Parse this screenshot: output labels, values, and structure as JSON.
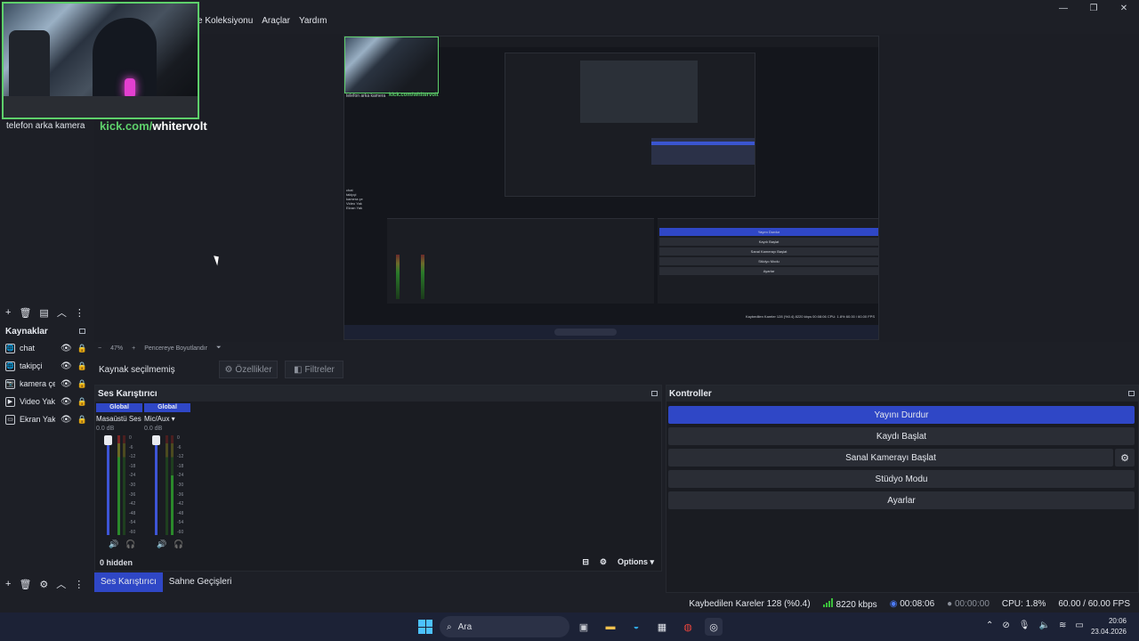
{
  "menu": {
    "items": [
      "e Koleksiyonu",
      "Araçlar",
      "Yardım"
    ]
  },
  "window_controls": {
    "minimize": "—",
    "maximize": "❐",
    "close": "✕"
  },
  "webcam": {
    "overlay_prefix": "kick.com/",
    "overlay_user": "whitervolt"
  },
  "scenes": {
    "items": [
      "telefon arka kamera"
    ],
    "toolbar": [
      "+",
      "🗑",
      "▤",
      "︿",
      "⋮"
    ]
  },
  "nested_preview": {
    "kick": "kick.com/whitervolt",
    "scene": "telefon arka kamera",
    "sources": [
      "chat",
      "takipçi",
      "kamera çe",
      "Video Yak",
      "Ekran Yak"
    ],
    "buttons": [
      "Yayını Durdur",
      "Kaydı Başlat",
      "Sanal Kamerayı Başlat",
      "Stüdyo Modu",
      "Ayarlar"
    ],
    "status": "Kaybedilen Kareler 128 (%0.4)   8220 kbps   00:08:06   CPU: 1.8%   60.00 / 60.00 FPS"
  },
  "zoom": {
    "minus": "−",
    "percent": "47%",
    "plus": "+",
    "mode": "Pencereye Boyutlandır",
    "arrow": "⏷"
  },
  "sources": {
    "title": "Kaynaklar",
    "items": [
      {
        "name": "chat",
        "icon": "🌐"
      },
      {
        "name": "takipçi",
        "icon": "🌐"
      },
      {
        "name": "kamera çe",
        "icon": "📷"
      },
      {
        "name": "Video Yak",
        "icon": "▶"
      },
      {
        "name": "Ekran Yak",
        "icon": "▭"
      }
    ],
    "toolbar": [
      "+",
      "🗑",
      "⚙",
      "︿",
      "⋮"
    ]
  },
  "props": {
    "no_source": "Kaynak seçilmemiş",
    "properties": "Özellikler",
    "filters": "Filtreler"
  },
  "mixer": {
    "title": "Ses Karıştırıcı",
    "channels": [
      {
        "badge": "Global",
        "name": "Masaüstü Ses",
        "db": "0.0 dB"
      },
      {
        "badge": "Global",
        "name": "Mic/Aux",
        "db": "0.0 dB"
      }
    ],
    "scale": [
      "0",
      "-6",
      "-12",
      "-18",
      "-24",
      "-30",
      "-36",
      "-42",
      "-48",
      "-54",
      "-60"
    ],
    "hidden": "0 hidden",
    "options": "Options"
  },
  "dock_tabs": [
    "Ses Karıştırıcı",
    "Sahne Geçişleri"
  ],
  "controls": {
    "title": "Kontroller",
    "stop_stream": "Yayını Durdur",
    "start_record": "Kaydı Başlat",
    "virtual_cam": "Sanal Kamerayı Başlat",
    "studio_mode": "Stüdyo Modu",
    "settings": "Ayarlar"
  },
  "status": {
    "dropped": "Kaybedilen Kareler 128 (%0.4)",
    "bitrate": "8220 kbps",
    "stream_time": "00:08:06",
    "record_time": "00:00:00",
    "cpu": "CPU: 1.8%",
    "fps": "60.00 / 60.00 FPS"
  },
  "taskbar": {
    "search": "Ara",
    "time": "20:06",
    "date": "23.04.2026"
  },
  "colors": {
    "accent": "#2f47c6",
    "kick_green": "#5ed06b",
    "panel_bg": "#1d1f26"
  }
}
